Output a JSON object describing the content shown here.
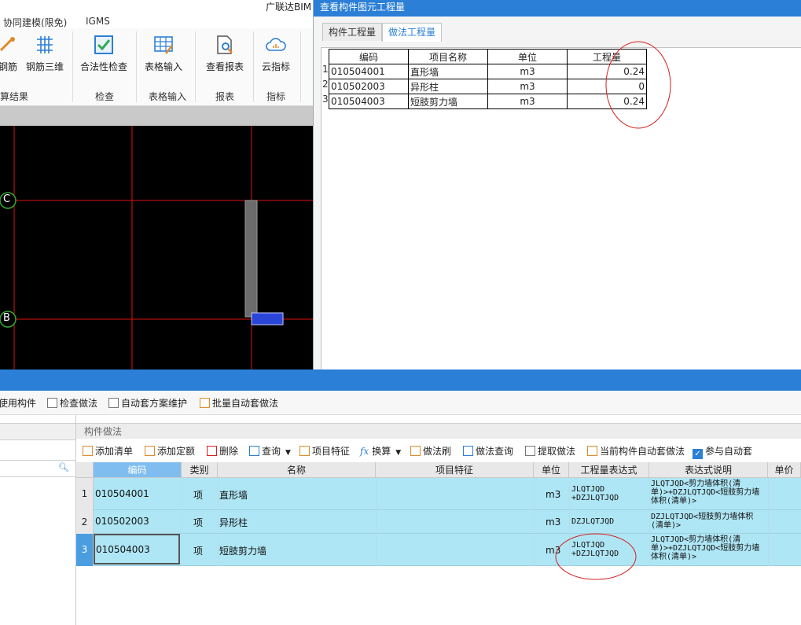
{
  "app": {
    "title": "广联达BIM"
  },
  "menu": {
    "tabs": [
      "协同建模(限免)",
      "IGMS"
    ]
  },
  "ribbon": {
    "buttons": [
      "钢筋",
      "钢筋三维",
      "合法性检查",
      "表格输入",
      "查看报表",
      "云指标"
    ],
    "groups": [
      "算结果",
      "检查",
      "表格输入",
      "报表",
      "指标"
    ]
  },
  "canvas": {
    "axis_c": "C",
    "axis_b": "B"
  },
  "dialog": {
    "title": "查看构件图元工程量",
    "tabs": [
      "构件工程量",
      "做法工程量"
    ],
    "table": {
      "headers": [
        "编码",
        "项目名称",
        "单位",
        "工程量"
      ],
      "rows": [
        {
          "num": "1",
          "code": "010504001",
          "name": "直形墙",
          "unit": "m3",
          "qty": "0.24"
        },
        {
          "num": "2",
          "code": "010502003",
          "name": "异形柱",
          "unit": "m3",
          "qty": "0"
        },
        {
          "num": "3",
          "code": "010504003",
          "name": "短肢剪力墙",
          "unit": "m3",
          "qty": "0.24"
        }
      ]
    }
  },
  "toolbar1": {
    "items": [
      "使用构件",
      "检查做法",
      "自动套方案维护",
      "批量自动套做法"
    ]
  },
  "panel": {
    "title": "构件做法"
  },
  "toolbar2": {
    "items": [
      "添加清单",
      "添加定额",
      "删除",
      "查询",
      "项目特征",
      "换算",
      "做法刷",
      "做法查询",
      "提取做法",
      "当前构件自动套做法",
      "参与自动套"
    ],
    "fx": "fx"
  },
  "grid": {
    "headers": [
      "编码",
      "类别",
      "名称",
      "项目特征",
      "单位",
      "工程量表达式",
      "表达式说明",
      "单价"
    ],
    "rows": [
      {
        "num": "1",
        "code": "010504001",
        "type": "项",
        "name": "直形墙",
        "unit": "m3",
        "expr": "JLQTJQD +DZJLQTJQD",
        "desc": "JLQTJQD<剪力墙体积(清单)>+DZJLQTJQD<短肢剪力墙体积(清单)>"
      },
      {
        "num": "2",
        "code": "010502003",
        "type": "项",
        "name": "异形柱",
        "unit": "m3",
        "expr": "DZJLQTJQD",
        "desc": "DZJLQTJQD<短肢剪力墙体积(清单)>"
      },
      {
        "num": "3",
        "code": "010504003",
        "type": "项",
        "name": "短肢剪力墙",
        "unit": "m3",
        "expr": "JLQTJQD +DZJLQTJQD",
        "desc": "JLQTJQD<剪力墙体积(清单)>+DZJLQTJQD<短肢剪力墙体积(清单)>"
      }
    ]
  }
}
